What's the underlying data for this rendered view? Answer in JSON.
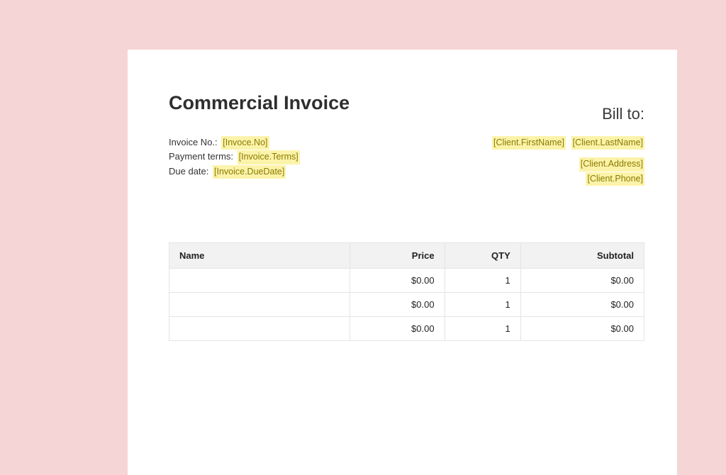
{
  "title": "Commercial Invoice",
  "bill_to_label": "Bill to:",
  "meta": {
    "invoice_no_label": "Invoice No.:",
    "invoice_no_token": "[Invoce.No]",
    "payment_terms_label": "Payment terms:",
    "payment_terms_token": "[Invoice.Terms]",
    "due_date_label": "Due date:",
    "due_date_token": "[Invoice.DueDate]"
  },
  "client": {
    "first_name_token": "[Client.FirstName]",
    "last_name_token": "[Client.LastName]",
    "address_token": "[Client.Address]",
    "phone_token": "[Client.Phone]"
  },
  "table": {
    "headers": {
      "name": "Name",
      "price": "Price",
      "qty": "QTY",
      "subtotal": "Subtotal"
    },
    "rows": [
      {
        "name": "",
        "price": "$0.00",
        "qty": "1",
        "subtotal": "$0.00"
      },
      {
        "name": "",
        "price": "$0.00",
        "qty": "1",
        "subtotal": "$0.00"
      },
      {
        "name": "",
        "price": "$0.00",
        "qty": "1",
        "subtotal": "$0.00"
      }
    ]
  }
}
